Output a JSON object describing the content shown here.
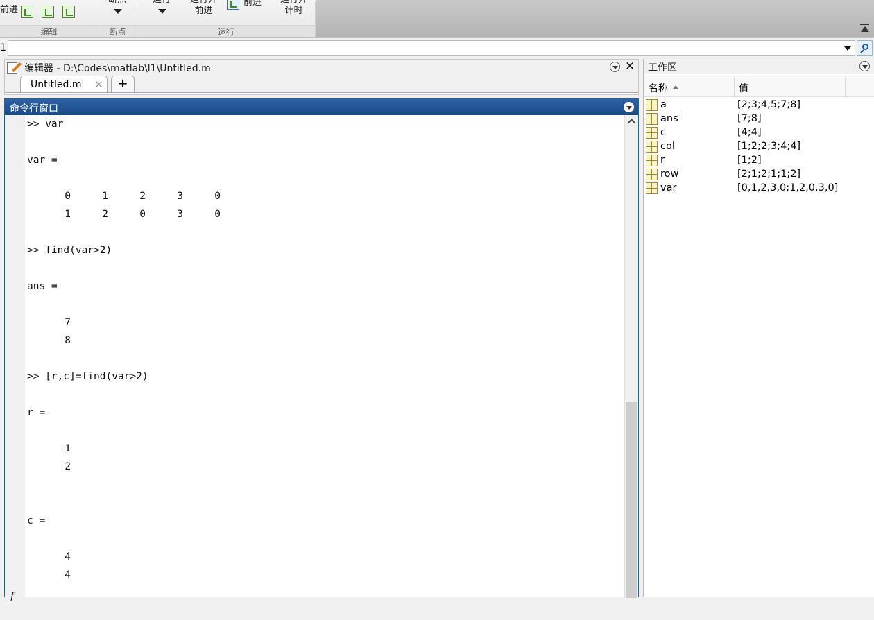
{
  "toolstrip": {
    "left_fragment": "前进",
    "breakpoints_label": "断点",
    "run_label": "运行",
    "run_advance_label_line1": "运行并",
    "run_advance_label_line2": "前进",
    "advance_label": "前进",
    "run_time_label_line1": "运行并",
    "run_time_label_line2": "计时",
    "groups": {
      "edit": "编辑",
      "breakpoints": "断点",
      "run": "运行"
    }
  },
  "address_bar": {
    "prefix": "1",
    "value": ""
  },
  "editor": {
    "title": "编辑器 - D:\\Codes\\matlab\\l1\\Untitled.m",
    "tab_label": "Untitled.m",
    "tab_close": "✕",
    "add_tab": "+",
    "close": "✕"
  },
  "command_window": {
    "title": "命令行窗口",
    "fx_prompt": "f",
    "lines": [
      ">> var",
      "var =",
      ">> find(var>2)",
      "ans =",
      ">> [r,c]=find(var>2)",
      "r =",
      "c ="
    ],
    "var_matrix": [
      [
        "0",
        "1",
        "2",
        "3",
        "0"
      ],
      [
        "1",
        "2",
        "0",
        "3",
        "0"
      ]
    ],
    "ans_values": [
      "7",
      "8"
    ],
    "r_values": [
      "1",
      "2"
    ],
    "c_values": [
      "4",
      "4"
    ]
  },
  "workspace": {
    "title": "工作区",
    "columns": {
      "name": "名称",
      "value": "值"
    },
    "rows": [
      {
        "name": "a",
        "value": "[2;3;4;5;7;8]"
      },
      {
        "name": "ans",
        "value": "[7;8]"
      },
      {
        "name": "c",
        "value": "[4;4]"
      },
      {
        "name": "col",
        "value": "[1;2;2;3;4;4]"
      },
      {
        "name": "r",
        "value": "[1;2]"
      },
      {
        "name": "row",
        "value": "[2;1;2;1;1;2]"
      },
      {
        "name": "var",
        "value": "[0,1,2,3,0;1,2,0,3,0]"
      }
    ]
  }
}
